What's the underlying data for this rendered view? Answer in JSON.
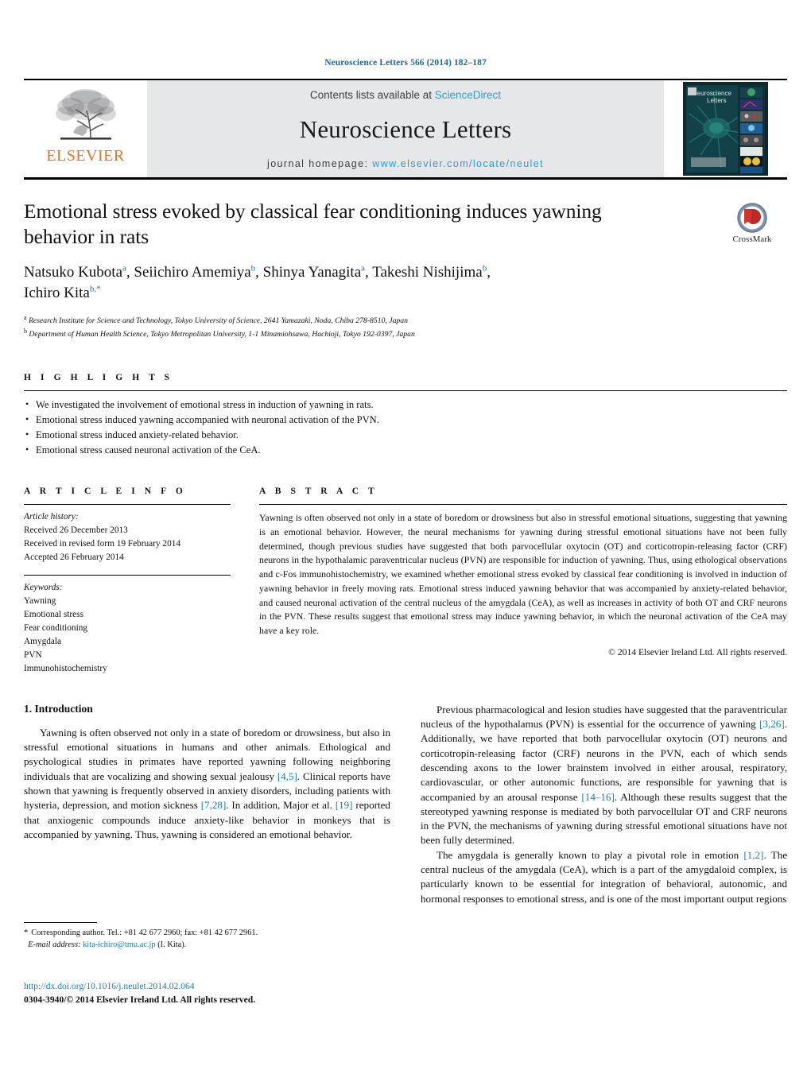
{
  "running_head": "Neuroscience Letters 566 (2014) 182–187",
  "masthead": {
    "contents_prefix": "Contents lists available at",
    "sciencedirect": "ScienceDirect",
    "journal_name": "Neuroscience Letters",
    "homepage_prefix": "journal homepage:",
    "homepage_url": "www.elsevier.com/locate/neulet",
    "publisher_logo_text": "ELSEVIER",
    "cover_title_line1": "Neuroscience",
    "cover_title_line2": "Letters",
    "accent_orange": "#E9711C",
    "accent_blue": "#2a9fd0",
    "panel_gray": "#e6e7e8"
  },
  "crossmark": {
    "label": "CrossMark",
    "ring_color": "#6a89a0",
    "book_color": "#d0342c"
  },
  "article": {
    "title": "Emotional stress evoked by classical fear conditioning induces yawning behavior in rats",
    "authors_line1_a": "Natsuko Kubota",
    "authors_line1_a_sup": "a",
    "authors_line1_b": ", Seiichiro Amemiya",
    "authors_line1_b_sup": "b",
    "authors_line1_c": ", Shinya Yanagita",
    "authors_line1_c_sup": "a",
    "authors_line1_d": ", Takeshi Nishijima",
    "authors_line1_d_sup": "b",
    "authors_line1_tail": ",",
    "authors_line2": "Ichiro Kita",
    "authors_line2_sup": "b,*",
    "affiliation_a_marker": "a",
    "affiliation_a": "Research Institute for Science and Technology, Tokyo University of Science, 2641 Yamazaki, Noda, Chiba 278-8510, Japan",
    "affiliation_b_marker": "b",
    "affiliation_b": "Department of Human Health Science, Tokyo Metropolitan University, 1-1 Minamiohsawa, Hachioji, Tokyo 192-0397, Japan"
  },
  "highlights": {
    "heading": "H I G H L I G H T S",
    "items": [
      "We investigated the involvement of emotional stress in induction of yawning in rats.",
      "Emotional stress induced yawning accompanied with neuronal activation of the PVN.",
      "Emotional stress induced anxiety-related behavior.",
      "Emotional stress caused neuronal activation of the CeA."
    ]
  },
  "article_info": {
    "heading": "A R T I C L E   I N F O",
    "history_label": "Article history:",
    "history": [
      "Received 26 December 2013",
      "Received in revised form 19 February 2014",
      "Accepted 26 February 2014"
    ],
    "keywords_label": "Keywords:",
    "keywords": [
      "Yawning",
      "Emotional stress",
      "Fear conditioning",
      "Amygdala",
      "PVN",
      "Immunohistochemistry"
    ]
  },
  "abstract": {
    "heading": "A B S T R A C T",
    "text": "Yawning is often observed not only in a state of boredom or drowsiness but also in stressful emotional situations, suggesting that yawning is an emotional behavior. However, the neural mechanisms for yawning during stressful emotional situations have not been fully determined, though previous studies have suggested that both parvocellular oxytocin (OT) and corticotropin-releasing factor (CRF) neurons in the hypothalamic paraventricular nucleus (PVN) are responsible for induction of yawning. Thus, using ethological observations and c-Fos immunohistochemistry, we examined whether emotional stress evoked by classical fear conditioning is involved in induction of yawning behavior in freely moving rats. Emotional stress induced yawning behavior that was accompanied by anxiety-related behavior, and caused neuronal activation of the central nucleus of the amygdala (CeA), as well as increases in activity of both OT and CRF neurons in the PVN. These results suggest that emotional stress may induce yawning behavior, in which the neuronal activation of the CeA may have a key role.",
    "copyright": "© 2014 Elsevier Ireland Ltd. All rights reserved."
  },
  "introduction": {
    "section_number_title": "1.  Introduction",
    "left_para1_pre": "Yawning is often observed not only in a state of boredom or drowsiness, but also in stressful emotional situations in humans and other animals. Ethological and psychological studies in primates have reported yawning following neighboring individuals that are vocalizing and showing sexual jealousy ",
    "left_ref1": "[4,5]",
    "left_para1_mid1": ". Clinical reports have shown that yawning is frequently observed in anxiety disorders, including patients with hysteria, depression, and motion sickness ",
    "left_ref2": "[7,28]",
    "left_para1_mid2": ". In addition, Major et al. ",
    "left_ref3": "[19]",
    "left_para1_end": " reported that anxiogenic compounds induce anxiety-like behavior in monkeys that is accompanied by yawning. Thus, yawning is considered an emotional behavior.",
    "right_para1_pre": "Previous pharmacological and lesion studies have suggested that the paraventricular nucleus of the hypothalamus (PVN) is essential for the occurrence of yawning ",
    "right_ref1": "[3,26]",
    "right_para1_mid": ". Additionally, we have reported that both parvocellular oxytocin (OT) neurons and corticotropin-releasing factor (CRF) neurons in the PVN, each of which sends descending axons to the lower brainstem involved in either arousal, respiratory, cardiovascular, or other autonomic functions, are responsible for yawning that is accompanied by an arousal response ",
    "right_ref2": "[14–16]",
    "right_para1_end": ". Although these results suggest that the stereotyped yawning response is mediated by both parvocellular OT and CRF neurons in the PVN, the mechanisms of yawning during stressful emotional situations have not been fully determined.",
    "right_para2_pre": "The amygdala is generally known to play a pivotal role in emotion ",
    "right_ref3": "[1,2]",
    "right_para2_end": ". The central nucleus of the amygdala (CeA), which is a part of the amygdaloid complex, is particularly known to be essential for integration of behavioral, autonomic, and hormonal responses to emotional stress, and is one of the most important output regions"
  },
  "footnote": {
    "star": "*",
    "corresponding": "Corresponding author. Tel.: +81 42 677 2960; fax: +81 42 677 2961.",
    "email_label": "E-mail address:",
    "email": "kita-ichiro@tmu.ac.jp",
    "email_owner": "(I. Kita)."
  },
  "footer": {
    "doi": "http://dx.doi.org/10.1016/j.neulet.2014.02.064",
    "issn_line": "0304-3940/© 2014 Elsevier Ireland Ltd. All rights reserved."
  }
}
